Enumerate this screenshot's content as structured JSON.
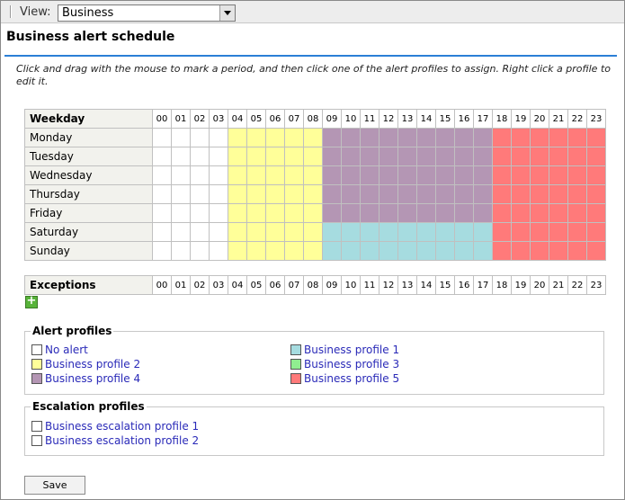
{
  "view": {
    "label": "View:",
    "selected": "Business"
  },
  "page_title": "Business alert schedule",
  "hint": "Click and drag with the mouse to mark a period, and then click one of the alert profiles to assign. Right click a profile to edit it.",
  "hours": [
    "00",
    "01",
    "02",
    "03",
    "04",
    "05",
    "06",
    "07",
    "08",
    "09",
    "10",
    "11",
    "12",
    "13",
    "14",
    "15",
    "16",
    "17",
    "18",
    "19",
    "20",
    "21",
    "22",
    "23"
  ],
  "schedule": {
    "header": "Weekday",
    "colors": {
      "none": "#ffffff",
      "p2": "#ffff99",
      "p4": "#b496b4",
      "p1": "#a6dce0",
      "p5": "#ff7a7a"
    },
    "rows": [
      {
        "day": "Monday",
        "profile_by_hour": [
          "none",
          "none",
          "none",
          "none",
          "p2",
          "p2",
          "p2",
          "p2",
          "p2",
          "p4",
          "p4",
          "p4",
          "p4",
          "p4",
          "p4",
          "p4",
          "p4",
          "p4",
          "p5",
          "p5",
          "p5",
          "p5",
          "p5",
          "p5"
        ]
      },
      {
        "day": "Tuesday",
        "profile_by_hour": [
          "none",
          "none",
          "none",
          "none",
          "p2",
          "p2",
          "p2",
          "p2",
          "p2",
          "p4",
          "p4",
          "p4",
          "p4",
          "p4",
          "p4",
          "p4",
          "p4",
          "p4",
          "p5",
          "p5",
          "p5",
          "p5",
          "p5",
          "p5"
        ]
      },
      {
        "day": "Wednesday",
        "profile_by_hour": [
          "none",
          "none",
          "none",
          "none",
          "p2",
          "p2",
          "p2",
          "p2",
          "p2",
          "p4",
          "p4",
          "p4",
          "p4",
          "p4",
          "p4",
          "p4",
          "p4",
          "p4",
          "p5",
          "p5",
          "p5",
          "p5",
          "p5",
          "p5"
        ]
      },
      {
        "day": "Thursday",
        "profile_by_hour": [
          "none",
          "none",
          "none",
          "none",
          "p2",
          "p2",
          "p2",
          "p2",
          "p2",
          "p4",
          "p4",
          "p4",
          "p4",
          "p4",
          "p4",
          "p4",
          "p4",
          "p4",
          "p5",
          "p5",
          "p5",
          "p5",
          "p5",
          "p5"
        ]
      },
      {
        "day": "Friday",
        "profile_by_hour": [
          "none",
          "none",
          "none",
          "none",
          "p2",
          "p2",
          "p2",
          "p2",
          "p2",
          "p4",
          "p4",
          "p4",
          "p4",
          "p4",
          "p4",
          "p4",
          "p4",
          "p4",
          "p5",
          "p5",
          "p5",
          "p5",
          "p5",
          "p5"
        ]
      },
      {
        "day": "Saturday",
        "profile_by_hour": [
          "none",
          "none",
          "none",
          "none",
          "p2",
          "p2",
          "p2",
          "p2",
          "p2",
          "p1",
          "p1",
          "p1",
          "p1",
          "p1",
          "p1",
          "p1",
          "p1",
          "p1",
          "p5",
          "p5",
          "p5",
          "p5",
          "p5",
          "p5"
        ]
      },
      {
        "day": "Sunday",
        "profile_by_hour": [
          "none",
          "none",
          "none",
          "none",
          "p2",
          "p2",
          "p2",
          "p2",
          "p2",
          "p1",
          "p1",
          "p1",
          "p1",
          "p1",
          "p1",
          "p1",
          "p1",
          "p1",
          "p5",
          "p5",
          "p5",
          "p5",
          "p5",
          "p5"
        ]
      }
    ]
  },
  "exceptions": {
    "header": "Exceptions",
    "add_icon": "plus-icon"
  },
  "alert_profiles": {
    "legend": "Alert profiles",
    "items": [
      {
        "label": "No alert",
        "color": "#ffffff"
      },
      {
        "label": "Business profile 1",
        "color": "#a6dce0"
      },
      {
        "label": "Business profile 2",
        "color": "#ffff99"
      },
      {
        "label": "Business profile 3",
        "color": "#90ee90"
      },
      {
        "label": "Business profile 4",
        "color": "#b496b4"
      },
      {
        "label": "Business profile 5",
        "color": "#ff7a7a"
      }
    ]
  },
  "escalation_profiles": {
    "legend": "Escalation profiles",
    "items": [
      {
        "label": "Business escalation profile 1",
        "color": "#ffffff"
      },
      {
        "label": "Business escalation profile 2",
        "color": "#ffffff"
      }
    ]
  },
  "save_label": "Save"
}
